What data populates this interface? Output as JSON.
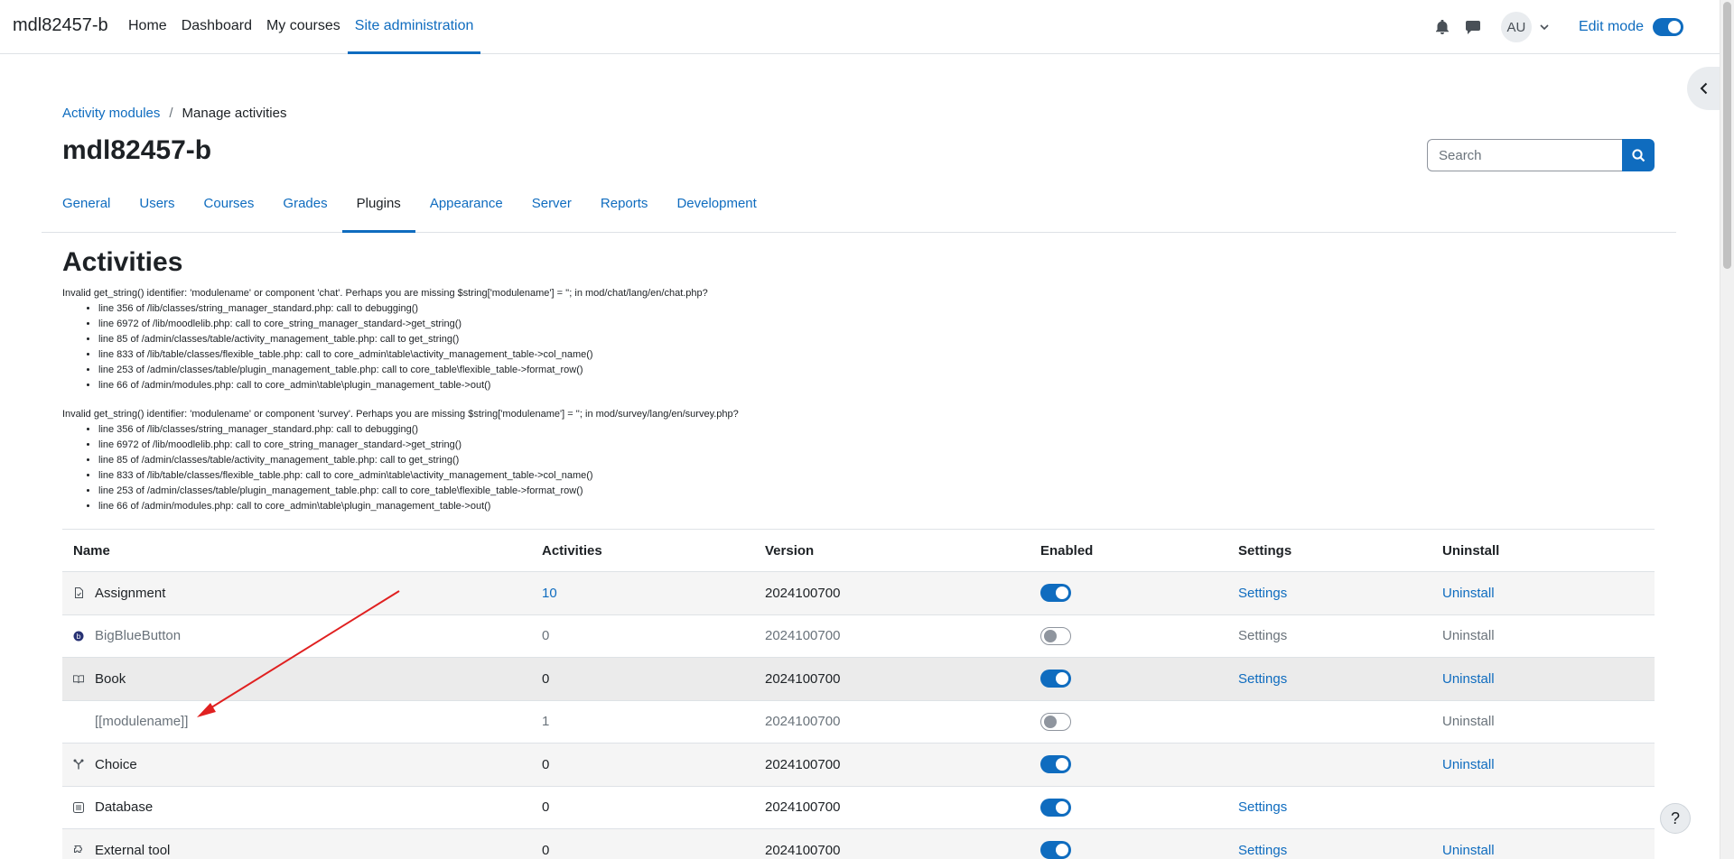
{
  "site": {
    "brand": "mdl82457-b"
  },
  "primary_nav": [
    "Home",
    "Dashboard",
    "My courses",
    "Site administration"
  ],
  "primary_nav_active": 3,
  "user": {
    "initials": "AU",
    "edit_mode_label": "Edit mode",
    "edit_mode_on": true
  },
  "breadcrumb": {
    "parent": "Activity modules",
    "current": "Manage activities"
  },
  "page_title": "mdl82457-b",
  "search": {
    "placeholder": "Search"
  },
  "secondary_nav": [
    "General",
    "Users",
    "Courses",
    "Grades",
    "Plugins",
    "Appearance",
    "Server",
    "Reports",
    "Development"
  ],
  "secondary_nav_active": 4,
  "section_heading": "Activities",
  "debug": [
    {
      "message": "Invalid get_string() identifier: 'modulename' or component 'chat'. Perhaps you are missing $string['modulename'] = ''; in mod/chat/lang/en/chat.php?",
      "lines": [
        "line 356 of /lib/classes/string_manager_standard.php: call to debugging()",
        "line 6972 of /lib/moodlelib.php: call to core_string_manager_standard->get_string()",
        "line 85 of /admin/classes/table/activity_management_table.php: call to get_string()",
        "line 833 of /lib/table/classes/flexible_table.php: call to core_admin\\table\\activity_management_table->col_name()",
        "line 253 of /admin/classes/table/plugin_management_table.php: call to core_table\\flexible_table->format_row()",
        "line 66 of /admin/modules.php: call to core_admin\\table\\plugin_management_table->out()"
      ]
    },
    {
      "message": "Invalid get_string() identifier: 'modulename' or component 'survey'. Perhaps you are missing $string['modulename'] = ''; in mod/survey/lang/en/survey.php?",
      "lines": [
        "line 356 of /lib/classes/string_manager_standard.php: call to debugging()",
        "line 6972 of /lib/moodlelib.php: call to core_string_manager_standard->get_string()",
        "line 85 of /admin/classes/table/activity_management_table.php: call to get_string()",
        "line 833 of /lib/table/classes/flexible_table.php: call to core_admin\\table\\activity_management_table->col_name()",
        "line 253 of /admin/classes/table/plugin_management_table.php: call to core_table\\flexible_table->format_row()",
        "line 66 of /admin/modules.php: call to core_admin\\table\\plugin_management_table->out()"
      ]
    }
  ],
  "table": {
    "headers": [
      "Name",
      "Activities",
      "Version",
      "Enabled",
      "Settings",
      "Uninstall"
    ],
    "rows": [
      {
        "name": "Assignment",
        "icon": "assignment-icon",
        "activities": "10",
        "activities_link": true,
        "version": "2024100700",
        "enabled": true,
        "settings": "Settings",
        "settings_link": true,
        "uninstall": "Uninstall",
        "uninstall_link": true
      },
      {
        "name": "BigBlueButton",
        "icon": "bigbluebutton-icon",
        "activities": "0",
        "activities_link": false,
        "version": "2024100700",
        "enabled": false,
        "settings": "Settings",
        "settings_link": false,
        "uninstall": "Uninstall",
        "uninstall_link": false
      },
      {
        "name": "Book",
        "icon": "book-icon",
        "activities": "0",
        "activities_link": false,
        "version": "2024100700",
        "enabled": true,
        "settings": "Settings",
        "settings_link": true,
        "uninstall": "Uninstall",
        "uninstall_link": true
      },
      {
        "name": "[[modulename]]",
        "icon": "",
        "activities": "1",
        "activities_link": false,
        "version": "2024100700",
        "enabled": false,
        "settings": "",
        "settings_link": false,
        "uninstall": "Uninstall",
        "uninstall_link": false
      },
      {
        "name": "Choice",
        "icon": "choice-icon",
        "activities": "0",
        "activities_link": false,
        "version": "2024100700",
        "enabled": true,
        "settings": "",
        "settings_link": false,
        "uninstall": "Uninstall",
        "uninstall_link": true
      },
      {
        "name": "Database",
        "icon": "database-icon",
        "activities": "0",
        "activities_link": false,
        "version": "2024100700",
        "enabled": true,
        "settings": "Settings",
        "settings_link": true,
        "uninstall": "",
        "uninstall_link": false
      },
      {
        "name": "External tool",
        "icon": "external-tool-icon",
        "activities": "0",
        "activities_link": false,
        "version": "2024100700",
        "enabled": true,
        "settings": "Settings",
        "settings_link": true,
        "uninstall": "Uninstall",
        "uninstall_link": true
      }
    ]
  },
  "help": {
    "label": "?"
  },
  "colors": {
    "accent": "#0f6cbf",
    "annotation_arrow": "#e02020"
  }
}
